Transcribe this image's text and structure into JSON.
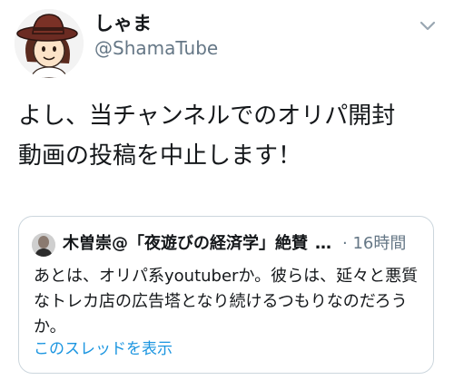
{
  "tweet": {
    "author": {
      "display_name": "しゃま",
      "handle": "@ShamaTube"
    },
    "text": "よし、当チャンネルでのオリパ開封\n動画の投稿を中止します！"
  },
  "quoted_tweet": {
    "author_name": "木曽崇@「夜遊びの経済学」絶賛",
    "ellipsis": "…",
    "time": "· 16時間",
    "text": "あとは、オリパ系youtuberか。彼らは、延々と悪質なトレカ店の広告塔となり続けるつもりなのだろうか。",
    "thread_link": "このスレッドを表示"
  },
  "colors": {
    "text_primary": "#14171a",
    "text_secondary": "#657786",
    "link": "#1b95e0",
    "border": "#ccd6dd"
  }
}
